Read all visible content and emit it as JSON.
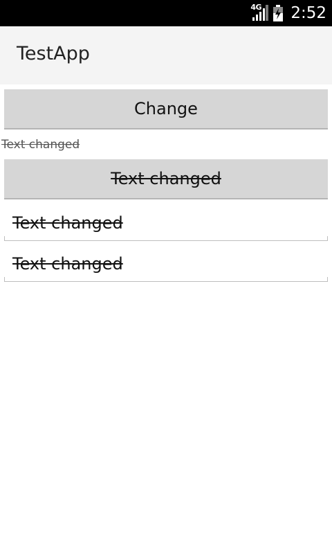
{
  "status_bar": {
    "network": "4G",
    "time": "2:52",
    "icons": [
      "signal-icon",
      "battery-icon"
    ]
  },
  "action_bar": {
    "title": "TestApp"
  },
  "content": {
    "change_button": "Change",
    "text_view": "Text changed",
    "struck_button": "Text changed",
    "edit_text_1": "Text changed",
    "edit_text_2": "Text changed"
  }
}
